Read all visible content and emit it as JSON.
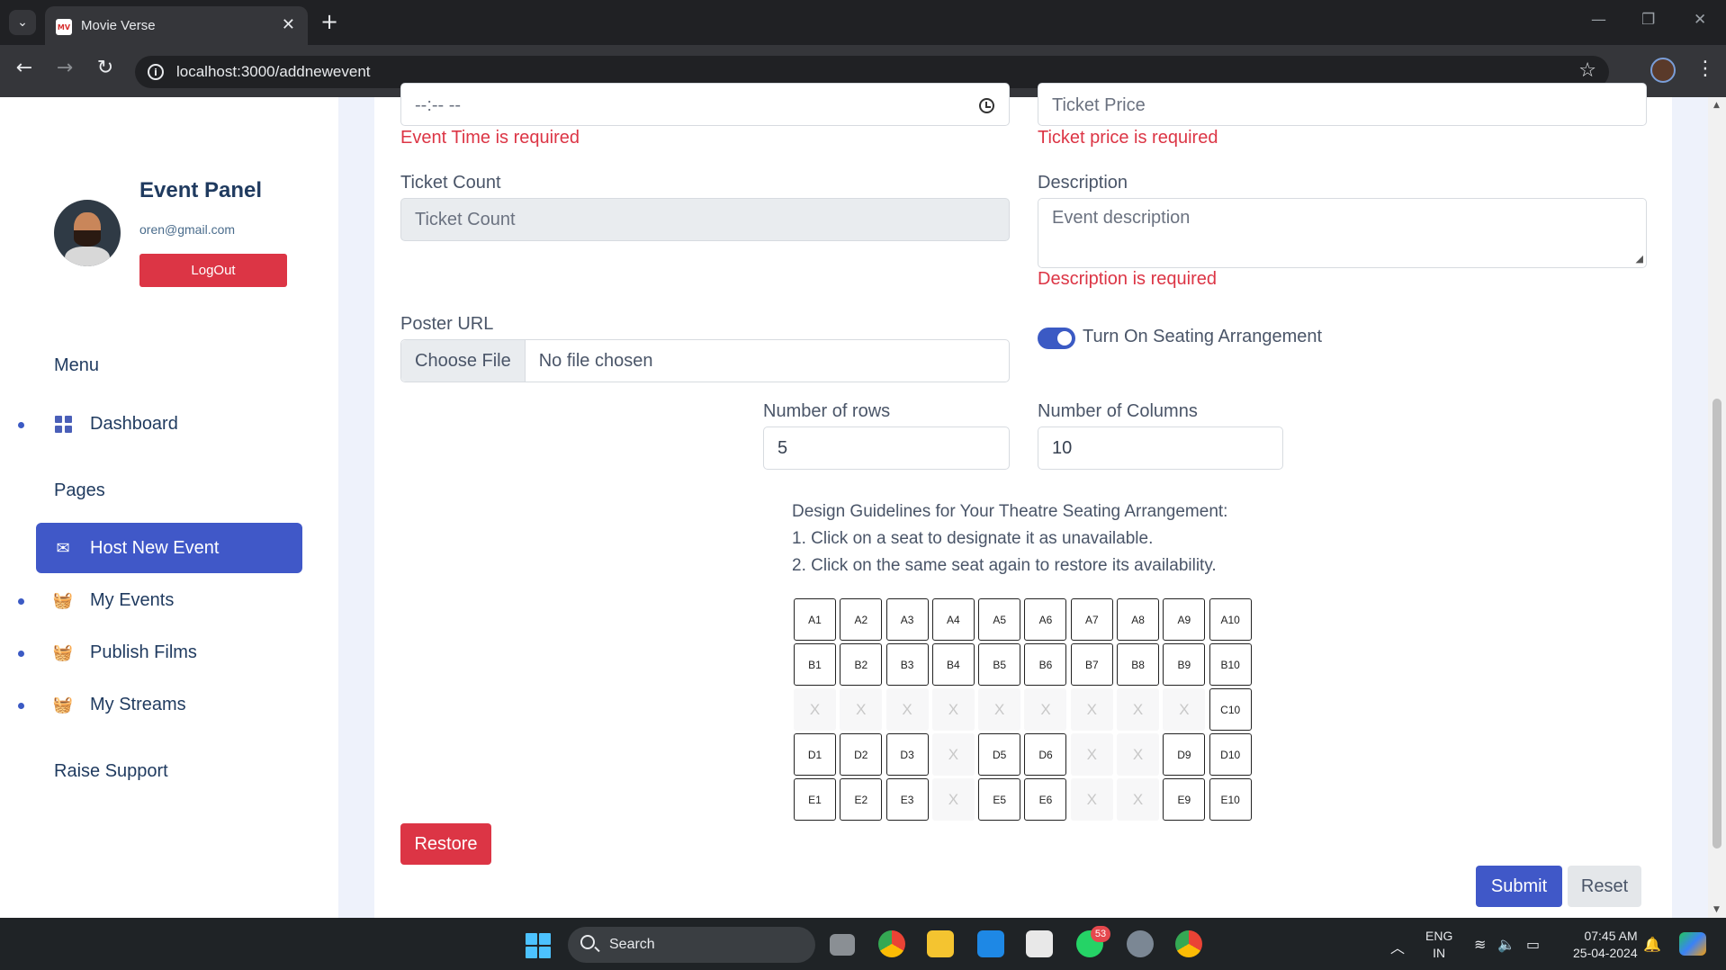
{
  "browser": {
    "tab_title": "Movie Verse",
    "favicon_text": "MV",
    "url": "localhost:3000/addnewevent"
  },
  "sidebar": {
    "panel_title": "Event Panel",
    "email": "oren@gmail.com",
    "logout_label": "LogOut",
    "menu_heading": "Menu",
    "pages_heading": "Pages",
    "items": [
      {
        "label": "Dashboard",
        "icon": "grid-icon"
      },
      {
        "label": "Host New Event",
        "icon": "envelope-icon",
        "active": true
      },
      {
        "label": "My Events",
        "icon": "basket-icon"
      },
      {
        "label": "Publish Films",
        "icon": "basket-icon"
      },
      {
        "label": "My Streams",
        "icon": "basket-icon"
      }
    ],
    "support_label": "Raise Support"
  },
  "form": {
    "event_time": {
      "placeholder": "--:-- --",
      "error": "Event Time is required"
    },
    "ticket_price": {
      "placeholder": "Ticket Price",
      "error": "Ticket price is required"
    },
    "ticket_count": {
      "label": "Ticket Count",
      "placeholder": "Ticket Count"
    },
    "description": {
      "label": "Description",
      "placeholder": "Event description",
      "error": "Description is required"
    },
    "poster": {
      "label": "Poster URL",
      "button": "Choose File",
      "status": "No file chosen"
    },
    "seating_toggle": {
      "label": "Turn On Seating Arrangement",
      "on": true
    },
    "rows": {
      "label": "Number of rows",
      "value": "5"
    },
    "columns": {
      "label": "Number of Columns",
      "value": "10"
    },
    "guidelines": [
      "Design Guidelines for Your Theatre Seating Arrangement:",
      "1. Click on a seat to designate it as unavailable.",
      "2. Click on the same seat again to restore its availability."
    ],
    "seat_grid": [
      [
        "A1",
        "A2",
        "A3",
        "A4",
        "A5",
        "A6",
        "A7",
        "A8",
        "A9",
        "A10"
      ],
      [
        "B1",
        "B2",
        "B3",
        "B4",
        "B5",
        "B6",
        "B7",
        "B8",
        "B9",
        "B10"
      ],
      [
        "X",
        "X",
        "X",
        "X",
        "X",
        "X",
        "X",
        "X",
        "X",
        "C10"
      ],
      [
        "D1",
        "D2",
        "D3",
        "X",
        "D5",
        "D6",
        "X",
        "X",
        "D9",
        "D10"
      ],
      [
        "E1",
        "E2",
        "E3",
        "X",
        "E5",
        "E6",
        "X",
        "X",
        "E9",
        "E10"
      ]
    ],
    "unavailable_mark": "X",
    "restore_label": "Restore",
    "submit_label": "Submit",
    "reset_label": "Reset"
  },
  "taskbar": {
    "search_label": "Search",
    "badge_count": "53",
    "lang_line1": "ENG",
    "lang_line2": "IN",
    "time": "07:45 AM",
    "date": "25-04-2024"
  },
  "colors": {
    "accent": "#4058c8",
    "danger": "#dc3545"
  }
}
